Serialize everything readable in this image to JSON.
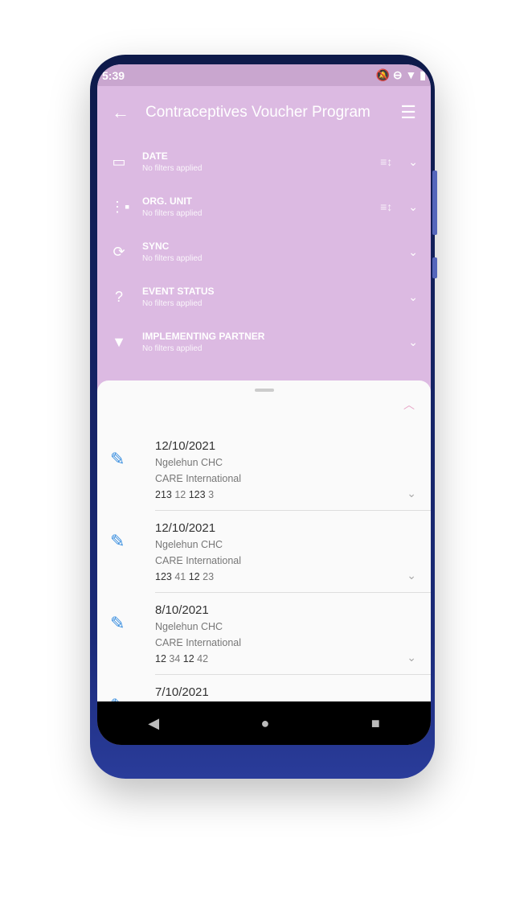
{
  "status": {
    "time": "5:39"
  },
  "appbar": {
    "title": "Contraceptives Voucher Program"
  },
  "filters": [
    {
      "label": "DATE",
      "sub": "No filters applied"
    },
    {
      "label": "ORG. UNIT",
      "sub": "No filters applied"
    },
    {
      "label": "SYNC",
      "sub": "No filters applied"
    },
    {
      "label": "EVENT STATUS",
      "sub": "No filters applied"
    },
    {
      "label": "IMPLEMENTING PARTNER",
      "sub": "No filters applied"
    }
  ],
  "events": [
    {
      "date": "12/10/2021",
      "org": "Ngelehun CHC",
      "partner": "CARE International",
      "v": [
        "213",
        "12",
        "123",
        "3"
      ]
    },
    {
      "date": "12/10/2021",
      "org": "Ngelehun CHC",
      "partner": "CARE International",
      "v": [
        "123",
        "41",
        "12",
        "23"
      ]
    },
    {
      "date": "8/10/2021",
      "org": "Ngelehun CHC",
      "partner": "CARE International",
      "v": [
        "12",
        "34",
        "12",
        "42"
      ]
    },
    {
      "date": "7/10/2021"
    }
  ]
}
